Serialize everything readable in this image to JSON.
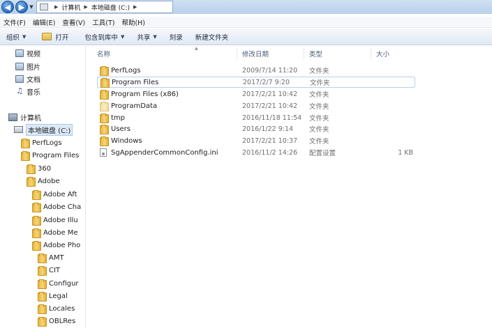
{
  "address": {
    "segments": [
      "计算机",
      "本地磁盘 (C:)"
    ]
  },
  "menu": [
    {
      "label": "文件(F)"
    },
    {
      "label": "编辑(E)"
    },
    {
      "label": "查看(V)"
    },
    {
      "label": "工具(T)"
    },
    {
      "label": "帮助(H)"
    }
  ],
  "toolbar": {
    "organize": "组织",
    "open": "打开",
    "include_in_library": "包含到库中",
    "share": "共享",
    "burn": "刻录",
    "new_folder": "新建文件夹"
  },
  "nav": {
    "libraries": [
      "视频",
      "图片",
      "文档",
      "音乐"
    ],
    "computer": "计算机",
    "drive": "本地磁盘 (C:)",
    "tree": [
      {
        "label": "PerfLogs"
      },
      {
        "label": "Program Files"
      },
      {
        "label": "360"
      },
      {
        "label": "Adobe"
      },
      {
        "label": "Adobe Aft"
      },
      {
        "label": "Adobe Cha"
      },
      {
        "label": "Adobe Illu"
      },
      {
        "label": "Adobe Me"
      },
      {
        "label": "Adobe Pho"
      },
      {
        "label": "AMT"
      },
      {
        "label": "CIT"
      },
      {
        "label": "Configur"
      },
      {
        "label": "Legal"
      },
      {
        "label": "Locales"
      },
      {
        "label": "OBLRes"
      }
    ]
  },
  "columns": {
    "name": "名称",
    "date": "修改日期",
    "type": "类型",
    "size": "大小"
  },
  "files": [
    {
      "name": "PerfLogs",
      "date": "2009/7/14 11:20",
      "type": "文件夹",
      "size": ""
    },
    {
      "name": "Program Files",
      "date": "2017/2/7 9:20",
      "type": "文件夹",
      "size": ""
    },
    {
      "name": "Program Files (x86)",
      "date": "2017/2/21 10:42",
      "type": "文件夹",
      "size": ""
    },
    {
      "name": "ProgramData",
      "date": "2017/2/21 10:42",
      "type": "文件夹",
      "size": ""
    },
    {
      "name": "tmp",
      "date": "2016/11/18 11:54",
      "type": "文件夹",
      "size": ""
    },
    {
      "name": "Users",
      "date": "2016/1/22 9:14",
      "type": "文件夹",
      "size": ""
    },
    {
      "name": "Windows",
      "date": "2017/2/21 10:37",
      "type": "文件夹",
      "size": ""
    },
    {
      "name": "SgAppenderCommonConfig.ini",
      "date": "2016/11/2 14:26",
      "type": "配置设置",
      "size": "1 KB"
    }
  ]
}
